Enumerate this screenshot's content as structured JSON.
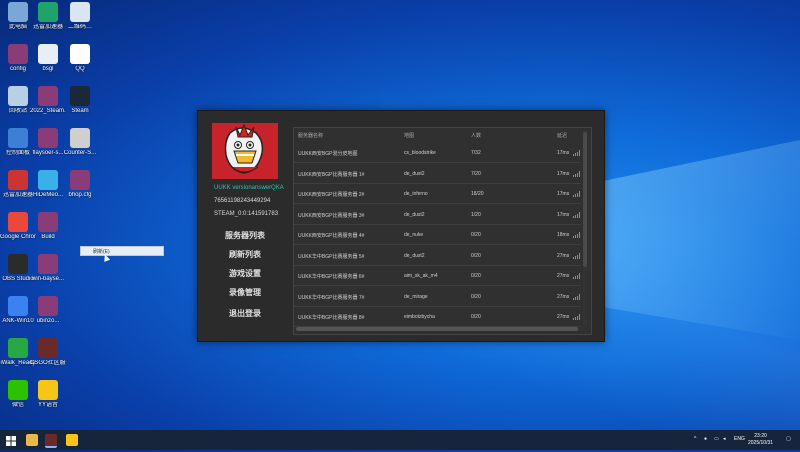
{
  "desktop": {
    "icons": [
      {
        "label": "此电脑",
        "color": "#7aa7d8"
      },
      {
        "label": "迅雷加速器",
        "color": "#1fa36b"
      },
      {
        "label": "二维码…",
        "color": "#d9e6f2"
      },
      {
        "label": "config",
        "color": "#8a3c78"
      },
      {
        "label": "bsgl",
        "color": "#e8eef5"
      },
      {
        "label": "QQ",
        "color": "#ffffff"
      },
      {
        "label": "回收站",
        "color": "#b9cfe6"
      },
      {
        "label": "2022_Steam...",
        "color": "#8a3c78"
      },
      {
        "label": "Steam",
        "color": "#1b2838"
      },
      {
        "label": "控制面板",
        "color": "#3d7fd6"
      },
      {
        "label": "flaysoer-s...",
        "color": "#8a3c78"
      },
      {
        "label": "Counter-S...",
        "color": "#cfcfcf"
      },
      {
        "label": "迅雷加速器",
        "color": "#c33"
      },
      {
        "label": "HiDeMeo...",
        "color": "#3ab0e8"
      },
      {
        "label": "bhop.cfg",
        "color": "#8a3c78"
      },
      {
        "label": "Google Chrome",
        "color": "#e9483b"
      },
      {
        "label": "Build",
        "color": "#8a3c78"
      },
      {
        "label": "OBS Studio",
        "color": "#2b2b2b"
      },
      {
        "label": "win-bayse...",
        "color": "#8a3c78"
      },
      {
        "label": "ANK-Win10",
        "color": "#3a82f0"
      },
      {
        "label": "ubinzo...",
        "color": "#8a3c78"
      },
      {
        "label": "iWalk_Ready",
        "color": "#27a844"
      },
      {
        "label": "CSGO社区服 V2.0",
        "color": "#6b2a2a"
      },
      {
        "label": "微信",
        "color": "#2dc100"
      },
      {
        "label": "YY语音",
        "color": "#f5c518"
      }
    ],
    "context_tip": "刷新(E)"
  },
  "app": {
    "user": {
      "name": "UUKK versionanswerQKA",
      "steam64": "76561198243449294",
      "steam_id": "STEAM_0:0:141591783"
    },
    "menu": [
      "服务器列表",
      "刷新列表",
      "游戏设置",
      "录像管理",
      "退出登录"
    ],
    "table": {
      "headers": {
        "name": "服务器名称",
        "map": "地图",
        "players": "人数",
        "ping": "延迟"
      },
      "rows": [
        {
          "name": "UUKK西安BGP混分皮地图",
          "map": "cs_bloodstrike",
          "players": "7/32",
          "ping": "17ms"
        },
        {
          "name": "UUKK西安BGP比赛服务器 1#",
          "map": "de_dust2",
          "players": "7/20",
          "ping": "17ms"
        },
        {
          "name": "UUKK西安BGP比赛服务器 2#",
          "map": "de_inferno",
          "players": "18/20",
          "ping": "17ms"
        },
        {
          "name": "UUKK西安BGP比赛服务器 3#",
          "map": "de_dust2",
          "players": "1/20",
          "ping": "17ms"
        },
        {
          "name": "UUKK西安BGP比赛服务器 4#",
          "map": "de_nuke",
          "players": "0/20",
          "ping": "18ms"
        },
        {
          "name": "UUKK华中BGP比赛服务器 5#",
          "map": "de_dust2",
          "players": "0/20",
          "ping": "27ms"
        },
        {
          "name": "UUKK华中BGP比赛服务器 6#",
          "map": "aim_sk_ak_m4",
          "players": "0/20",
          "ping": "27ms"
        },
        {
          "name": "UUKK华中BGP比赛服务器 7#",
          "map": "de_mirage",
          "players": "0/20",
          "ping": "27ms"
        },
        {
          "name": "UUKK华中BGP比赛服务器 8#",
          "map": "eimbotzbycha",
          "players": "0/20",
          "ping": "27ms"
        }
      ]
    }
  },
  "taskbar": {
    "lang": "ENG",
    "time": "23:20",
    "date": "2025/10/31"
  }
}
